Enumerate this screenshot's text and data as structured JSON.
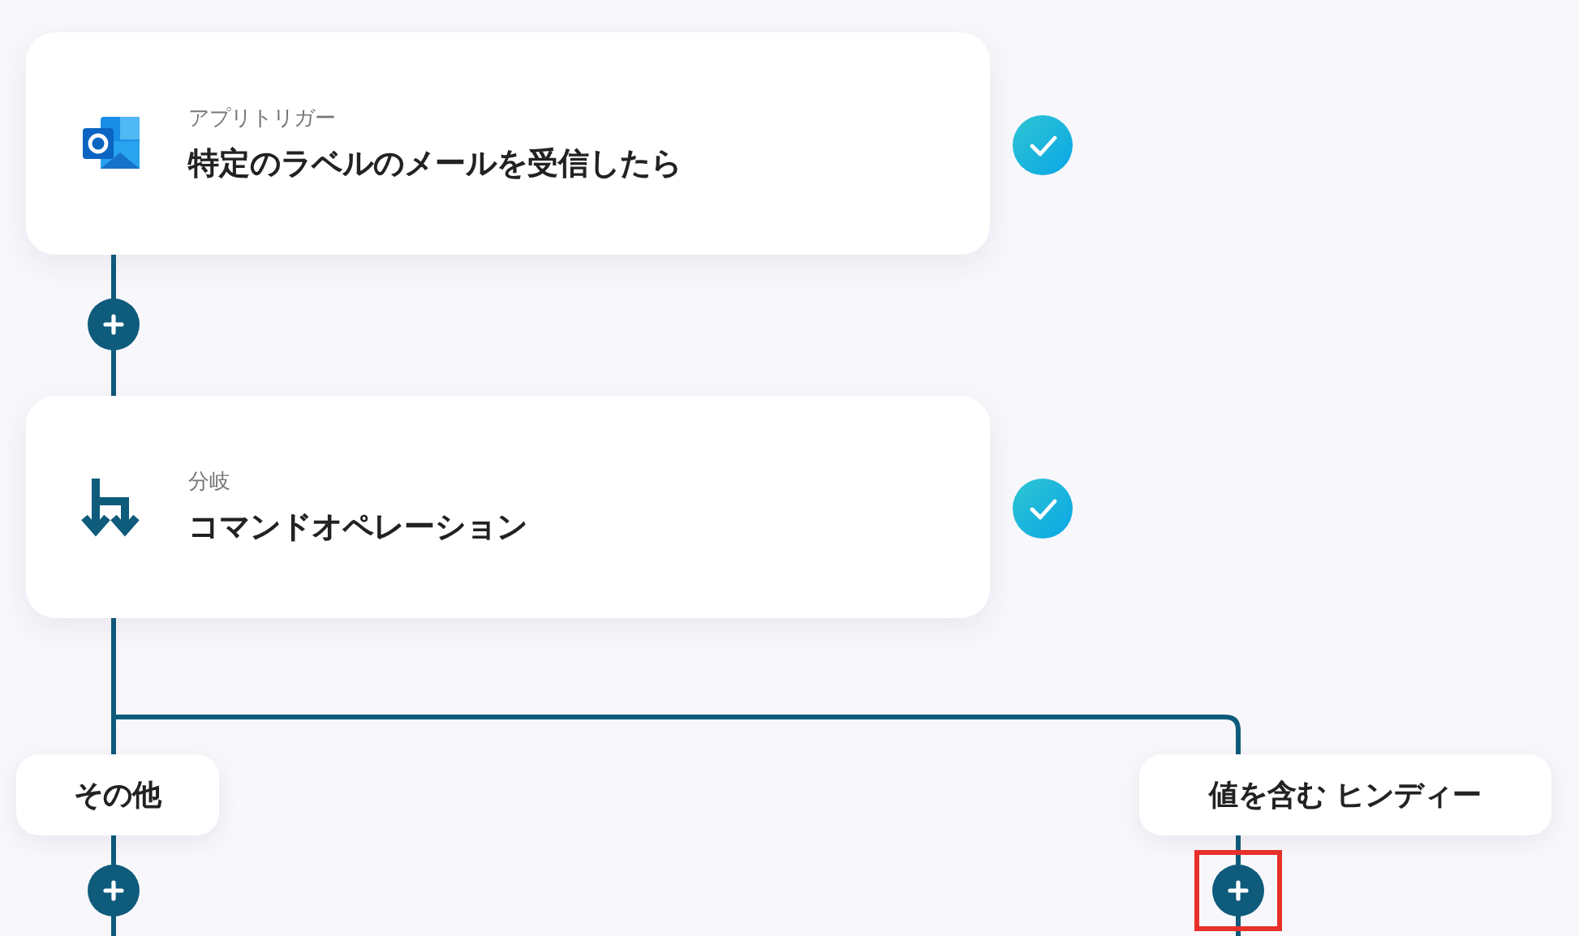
{
  "steps": [
    {
      "kind": "trigger",
      "category": "アプリトリガー",
      "title": "特定のラベルのメールを受信したら",
      "completed": true
    },
    {
      "kind": "branch",
      "category": "分岐",
      "title": "コマンドオペレーション",
      "completed": true
    }
  ],
  "branches": [
    {
      "label": "その他",
      "highlighted": false
    },
    {
      "label": "値を含む ヒンディー",
      "highlighted": true
    }
  ]
}
